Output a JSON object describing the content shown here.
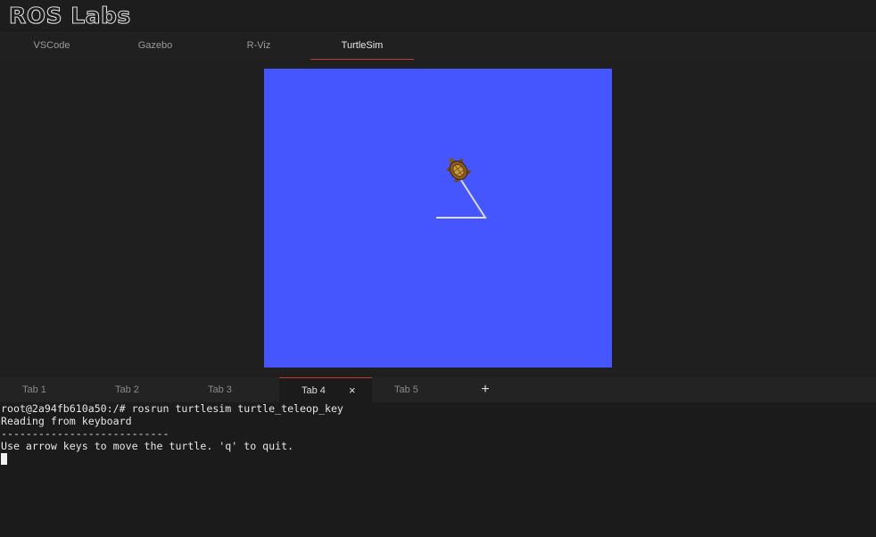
{
  "logo": {
    "text": "ROS Labs"
  },
  "app_tabs": [
    {
      "label": "VSCode",
      "active": false
    },
    {
      "label": "Gazebo",
      "active": false
    },
    {
      "label": "R-Viz",
      "active": false
    },
    {
      "label": "TurtleSim",
      "active": true
    }
  ],
  "turtlesim": {
    "background_color": "#4556ff",
    "pen_color": "#dcdcff"
  },
  "terminal_tabs": [
    {
      "label": "Tab 1",
      "active": false
    },
    {
      "label": "Tab 2",
      "active": false
    },
    {
      "label": "Tab 3",
      "active": false
    },
    {
      "label": "Tab 4",
      "active": true,
      "close_icon": "×"
    },
    {
      "label": "Tab 5",
      "active": false
    }
  ],
  "add_tab_icon": "+",
  "terminal": {
    "lines": [
      "root@2a94fb610a50:/# rosrun turtlesim turtle_teleop_key",
      "Reading from keyboard",
      "---------------------------",
      "Use arrow keys to move the turtle. 'q' to quit."
    ]
  },
  "colors": {
    "accent": "#c0392b",
    "background": "#1f1f1f"
  }
}
